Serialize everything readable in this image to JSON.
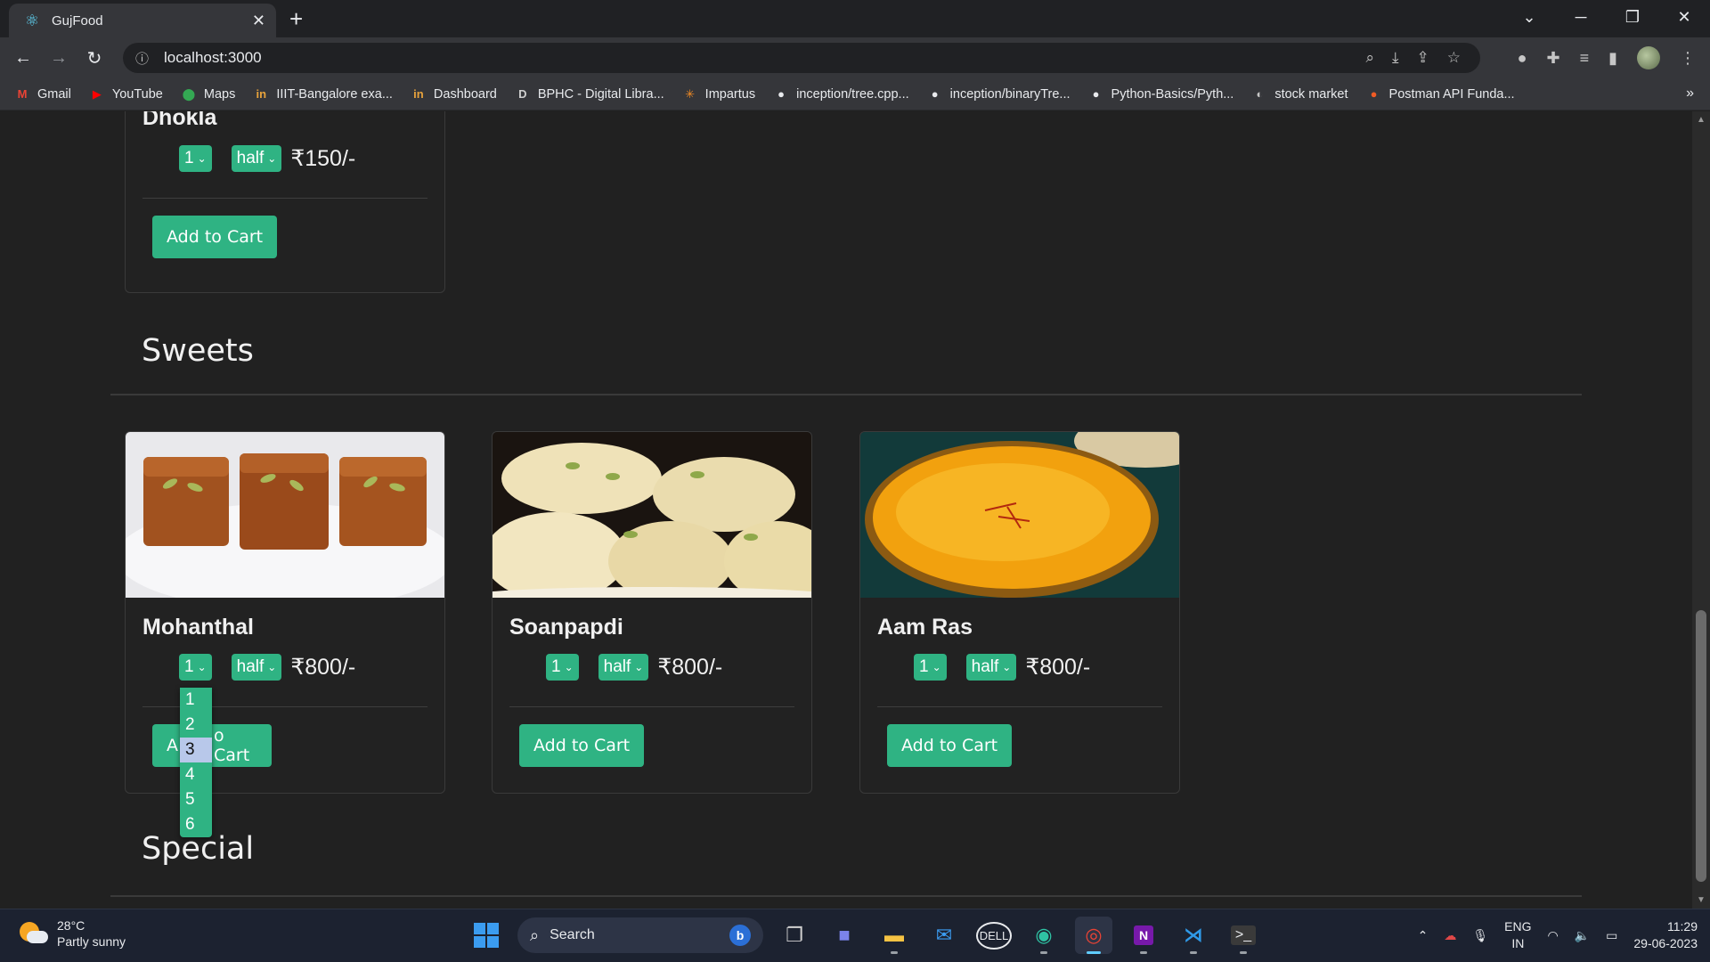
{
  "browser": {
    "tab_title": "GujFood",
    "url": "localhost:3000",
    "bookmarks": [
      {
        "label": "Gmail",
        "icon": "gmail-icon",
        "glyph": "M",
        "color": "#ea4335"
      },
      {
        "label": "YouTube",
        "icon": "youtube-icon",
        "glyph": "▶",
        "color": "#ff0000"
      },
      {
        "label": "Maps",
        "icon": "maps-icon",
        "glyph": "⬤",
        "color": "#34a853"
      },
      {
        "label": "IIIT-Bangalore exa...",
        "icon": "iiitb-icon",
        "glyph": "in",
        "color": "#e8a33c"
      },
      {
        "label": "Dashboard",
        "icon": "dashboard-icon",
        "glyph": "in",
        "color": "#e8a33c"
      },
      {
        "label": "BPHC - Digital Libra...",
        "icon": "library-icon",
        "glyph": "D",
        "color": "#cfcfcf"
      },
      {
        "label": "Impartus",
        "icon": "impartus-icon",
        "glyph": "✳",
        "color": "#f08a24"
      },
      {
        "label": "inception/tree.cpp...",
        "icon": "github-icon",
        "glyph": "●",
        "color": "#e8eaed"
      },
      {
        "label": "inception/binaryTre...",
        "icon": "github-icon",
        "glyph": "●",
        "color": "#e8eaed"
      },
      {
        "label": "Python-Basics/Pyth...",
        "icon": "github-icon",
        "glyph": "●",
        "color": "#e8eaed"
      },
      {
        "label": "stock market",
        "icon": "globe-icon",
        "glyph": "◐",
        "color": "#c6c6c6"
      },
      {
        "label": "Postman API Funda...",
        "icon": "postman-icon",
        "glyph": "●",
        "color": "#ef5b25"
      }
    ]
  },
  "page": {
    "top_card": {
      "name": "Dhokla",
      "qty": "1",
      "size": "half",
      "price": "₹150/-",
      "button": "Add to Cart"
    },
    "sections": [
      {
        "title": "Sweets"
      },
      {
        "title": "Special"
      }
    ],
    "sweets": [
      {
        "name": "Mohanthal",
        "qty": "1",
        "size": "half",
        "price": "₹800/-",
        "button": "Add to Cart"
      },
      {
        "name": "Soanpapdi",
        "qty": "1",
        "size": "half",
        "price": "₹800/-",
        "button": "Add to Cart"
      },
      {
        "name": "Aam Ras",
        "qty": "1",
        "size": "half",
        "price": "₹800/-",
        "button": "Add to Cart"
      }
    ],
    "qty_dropdown": {
      "options": [
        "1",
        "2",
        "3",
        "4",
        "5",
        "6"
      ],
      "highlighted": "3"
    },
    "cart_partial_left": "A",
    "cart_partial_right": "o Cart"
  },
  "taskbar": {
    "weather_temp": "28°C",
    "weather_desc": "Partly sunny",
    "search_label": "Search",
    "lang_top": "ENG",
    "lang_bottom": "IN",
    "time": "11:29",
    "date": "29-06-2023"
  },
  "colors": {
    "accent": "#2fb383",
    "page_bg": "#212121",
    "highlight": "#b8c8ea"
  }
}
